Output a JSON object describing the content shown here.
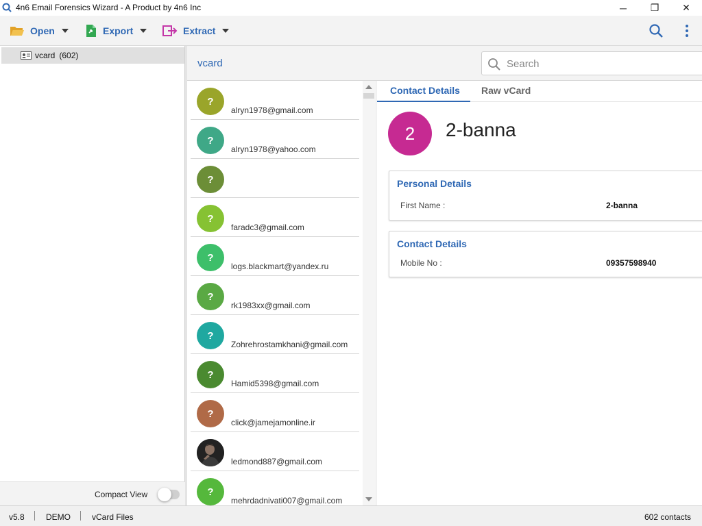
{
  "window": {
    "title": "4n6 Email Forensics Wizard - A Product by 4n6 Inc",
    "minimize_glyph": "─",
    "maximize_glyph": "❐",
    "close_glyph": "✕"
  },
  "toolbar": {
    "open_label": "Open",
    "export_label": "Export",
    "extract_label": "Extract"
  },
  "tree": {
    "items": [
      {
        "label": "vcard",
        "count": "(602)",
        "icon": "vcard-icon"
      }
    ]
  },
  "compact_view": {
    "label": "Compact View",
    "enabled": false
  },
  "main": {
    "folder_title": "vcard",
    "search": {
      "placeholder": "Search",
      "value": ""
    }
  },
  "contacts": [
    {
      "initial": "?",
      "email": "alryn1978@gmail.com",
      "color": "#9aa52a"
    },
    {
      "initial": "?",
      "email": "alryn1978@yahoo.com",
      "color": "#3fa887"
    },
    {
      "initial": "?",
      "email": "",
      "color": "#6c8e37"
    },
    {
      "initial": "?",
      "email": "faradc3@gmail.com",
      "color": "#86c233"
    },
    {
      "initial": "?",
      "email": "logs.blackmart@yandex.ru",
      "color": "#3dbf6a"
    },
    {
      "initial": "?",
      "email": "rk1983xx@gmail.com",
      "color": "#5aa944"
    },
    {
      "initial": "?",
      "email": "Zohrehrostamkhani@gmail.com",
      "color": "#1fa8a0"
    },
    {
      "initial": "?",
      "email": "Hamid5398@gmail.com",
      "color": "#4a8a30"
    },
    {
      "initial": "?",
      "email": "click@jamejamonline.ir",
      "color": "#b06a47"
    },
    {
      "initial": "",
      "email": "ledmond887@gmail.com",
      "color": "#1d1d1d"
    },
    {
      "initial": "?",
      "email": "mehrdadnivati007@gmail.com",
      "color": "#55b83c"
    }
  ],
  "detail": {
    "tabs": [
      {
        "label": "Contact Details",
        "active": true
      },
      {
        "label": "Raw vCard",
        "active": false
      }
    ],
    "avatar_initial": "2",
    "avatar_color": "#c62a92",
    "name": "2-banna",
    "personal_card": {
      "title": "Personal Details",
      "fields": [
        {
          "label": "First Name :",
          "value": "2-banna"
        }
      ]
    },
    "contact_card": {
      "title": "Contact Details",
      "fields": [
        {
          "label": "Mobile No :",
          "value": "09357598940"
        }
      ]
    }
  },
  "status": {
    "version": "v5.8",
    "mode": "DEMO",
    "file_type": "vCard Files",
    "count": "602 contacts"
  },
  "colors": {
    "accent": "#2f68b4"
  }
}
